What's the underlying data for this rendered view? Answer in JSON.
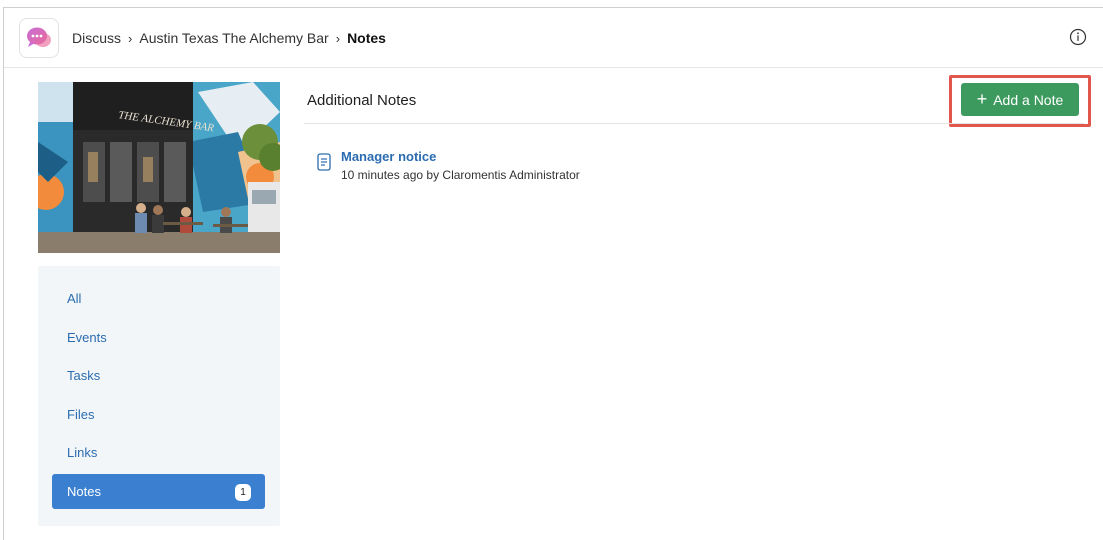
{
  "breadcrumb": {
    "root": "Discuss",
    "parent": "Austin Texas The Alchemy Bar",
    "current": "Notes"
  },
  "cover": {
    "sign_text": "THE ALCHEMY BAR"
  },
  "sidebar": {
    "items": [
      {
        "label": "All"
      },
      {
        "label": "Events"
      },
      {
        "label": "Tasks"
      },
      {
        "label": "Files"
      },
      {
        "label": "Links"
      },
      {
        "label": "Notes",
        "badge": "1",
        "active": true
      }
    ]
  },
  "main": {
    "title": "Additional Notes",
    "add_button_label": "Add a Note",
    "notes": [
      {
        "title": "Manager notice",
        "meta": "10 minutes ago by Claromentis Administrator"
      }
    ]
  },
  "colors": {
    "accent_blue": "#3b7fd1",
    "link_blue": "#2b6cb0",
    "add_green": "#3d9a5e",
    "highlight_red": "#e2574c"
  },
  "icons": {
    "app": "chat-bubbles-icon",
    "info": "info-circle-icon",
    "note": "document-icon",
    "plus": "plus-icon",
    "breadcrumb_sep": "chevron-right-icon"
  }
}
